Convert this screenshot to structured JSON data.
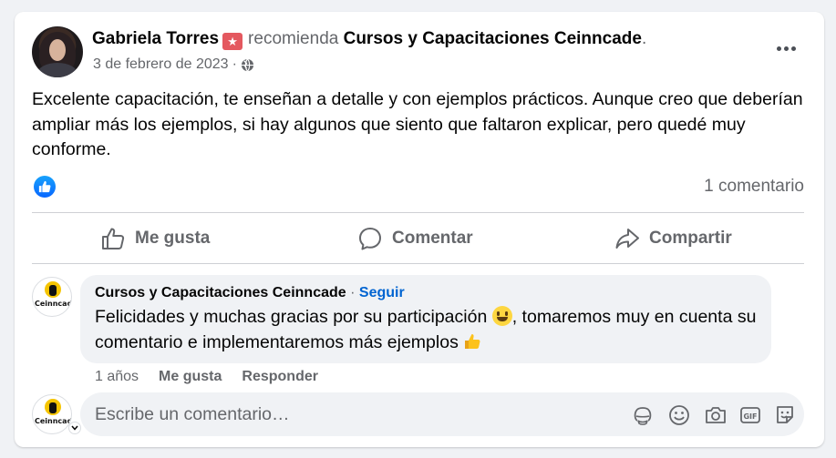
{
  "post": {
    "author": "Gabriela Torres",
    "recommends_text": "recomienda",
    "page_name": "Cursos y Capacitaciones Ceinncade",
    "period": ".",
    "date": "3 de febrero de 2023",
    "date_sep": "·",
    "body": "Excelente capacitación, te enseñan a detalle y con ejemplos prácticos. Aunque creo que deberían ampliar más los ejemplos, si hay algunos que siento que faltaron explicar, pero quedé muy conforme.",
    "comment_count": "1 comentario"
  },
  "actions": {
    "like": "Me gusta",
    "comment": "Comentar",
    "share": "Compartir"
  },
  "comment": {
    "author": "Cursos y Capacitaciones Ceinncade",
    "sep": "·",
    "follow": "Seguir",
    "text_part1": "Felicidades y muchas gracias por su participación",
    "text_part2": ", tomaremos muy en cuenta su comentario e implementaremos más ejemplos",
    "age": "1 años",
    "like": "Me gusta",
    "reply": "Responder",
    "avatar_label": "Ceinncade"
  },
  "composer": {
    "placeholder": "Escribe un comentario…"
  },
  "icons": [
    "recommend-badge-icon",
    "globe-icon",
    "more-options-icon",
    "like-reaction-icon",
    "like-icon",
    "comment-icon",
    "share-icon",
    "smile-emoji-icon",
    "thumbs-up-emoji-icon",
    "avatar-sticker-icon",
    "emoji-icon",
    "camera-icon",
    "gif-icon",
    "sticker-icon"
  ],
  "colors": {
    "accent_blue": "#0866ff",
    "follow_blue": "#0064d1",
    "recommend_red": "#e4585f",
    "secondary_text": "#65676b"
  }
}
